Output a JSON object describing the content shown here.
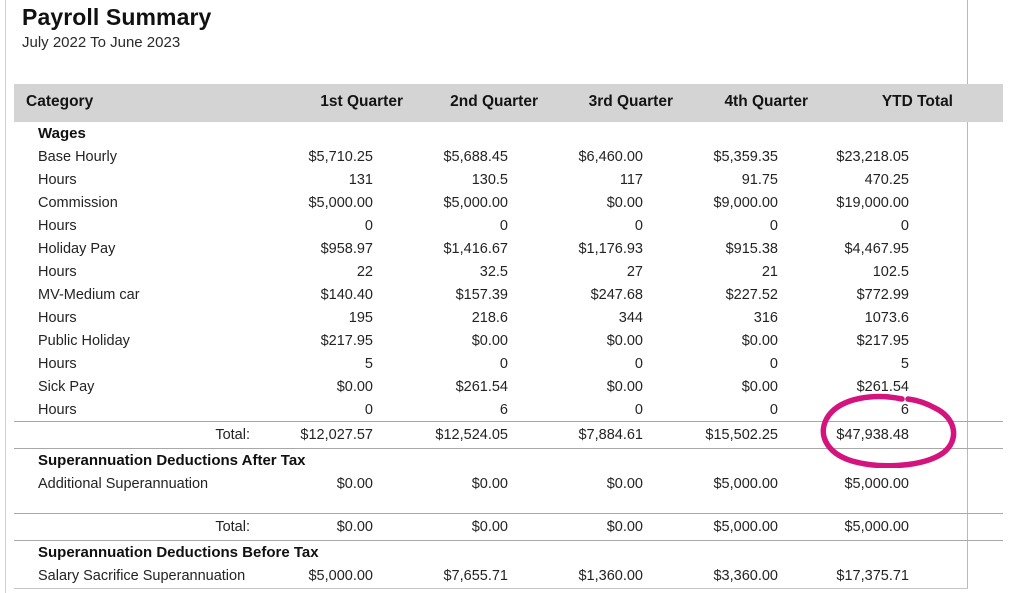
{
  "document": {
    "title": "Payroll Summary",
    "subtitle": "July 2022 To June 2023"
  },
  "table": {
    "columns": [
      {
        "key": "category",
        "label": "Category",
        "align": "left"
      },
      {
        "key": "q1",
        "label": "1st Quarter",
        "align": "right"
      },
      {
        "key": "q2",
        "label": "2nd Quarter",
        "align": "right"
      },
      {
        "key": "q3",
        "label": "3rd Quarter",
        "align": "right"
      },
      {
        "key": "q4",
        "label": "4th Quarter",
        "align": "right"
      },
      {
        "key": "ytd",
        "label": "YTD Total",
        "align": "right"
      }
    ],
    "total_label": "Total:",
    "sections": [
      {
        "name": "Wages",
        "rows": [
          {
            "category": "Base Hourly",
            "q1": "$5,710.25",
            "q2": "$5,688.45",
            "q3": "$6,460.00",
            "q4": "$5,359.35",
            "ytd": "$23,218.05"
          },
          {
            "category": "Hours",
            "q1": "131",
            "q2": "130.5",
            "q3": "117",
            "q4": "91.75",
            "ytd": "470.25"
          },
          {
            "category": "Commission",
            "q1": "$5,000.00",
            "q2": "$5,000.00",
            "q3": "$0.00",
            "q4": "$9,000.00",
            "ytd": "$19,000.00"
          },
          {
            "category": "Hours",
            "q1": "0",
            "q2": "0",
            "q3": "0",
            "q4": "0",
            "ytd": "0"
          },
          {
            "category": "Holiday Pay",
            "q1": "$958.97",
            "q2": "$1,416.67",
            "q3": "$1,176.93",
            "q4": "$915.38",
            "ytd": "$4,467.95"
          },
          {
            "category": "Hours",
            "q1": "22",
            "q2": "32.5",
            "q3": "27",
            "q4": "21",
            "ytd": "102.5"
          },
          {
            "category": "MV-Medium car",
            "q1": "$140.40",
            "q2": "$157.39",
            "q3": "$247.68",
            "q4": "$227.52",
            "ytd": "$772.99"
          },
          {
            "category": "Hours",
            "q1": "195",
            "q2": "218.6",
            "q3": "344",
            "q4": "316",
            "ytd": "1073.6"
          },
          {
            "category": "Public Holiday",
            "q1": "$217.95",
            "q2": "$0.00",
            "q3": "$0.00",
            "q4": "$0.00",
            "ytd": "$217.95"
          },
          {
            "category": "Hours",
            "q1": "5",
            "q2": "0",
            "q3": "0",
            "q4": "0",
            "ytd": "5"
          },
          {
            "category": "Sick Pay",
            "q1": "$0.00",
            "q2": "$261.54",
            "q3": "$0.00",
            "q4": "$0.00",
            "ytd": "$261.54"
          },
          {
            "category": "Hours",
            "q1": "0",
            "q2": "6",
            "q3": "0",
            "q4": "0",
            "ytd": "6"
          }
        ],
        "total": {
          "q1": "$12,027.57",
          "q2": "$12,524.05",
          "q3": "$7,884.61",
          "q4": "$15,502.25",
          "ytd": "$47,938.48"
        }
      },
      {
        "name": "Superannuation Deductions After Tax",
        "rows": [
          {
            "category": "Additional Superannuation",
            "q1": "$0.00",
            "q2": "$0.00",
            "q3": "$0.00",
            "q4": "$5,000.00",
            "ytd": "$5,000.00"
          }
        ],
        "total": {
          "q1": "$0.00",
          "q2": "$0.00",
          "q3": "$0.00",
          "q4": "$5,000.00",
          "ytd": "$5,000.00"
        }
      },
      {
        "name": "Superannuation Deductions Before Tax",
        "rows": [
          {
            "category": "Salary Sacrifice Superannuation",
            "q1": "$5,000.00",
            "q2": "$7,655.71",
            "q3": "$1,360.00",
            "q4": "$3,360.00",
            "ytd": "$17,375.71"
          }
        ],
        "total": null
      }
    ]
  },
  "annotation": {
    "type": "hand-drawn-ellipse",
    "color": "#D4147E",
    "highlights_value": "$47,938.48"
  },
  "colors": {
    "header_band": "#d4d4d4",
    "rule": "#a8a8a8",
    "text": "#232323",
    "annotation": "#D4147E"
  }
}
